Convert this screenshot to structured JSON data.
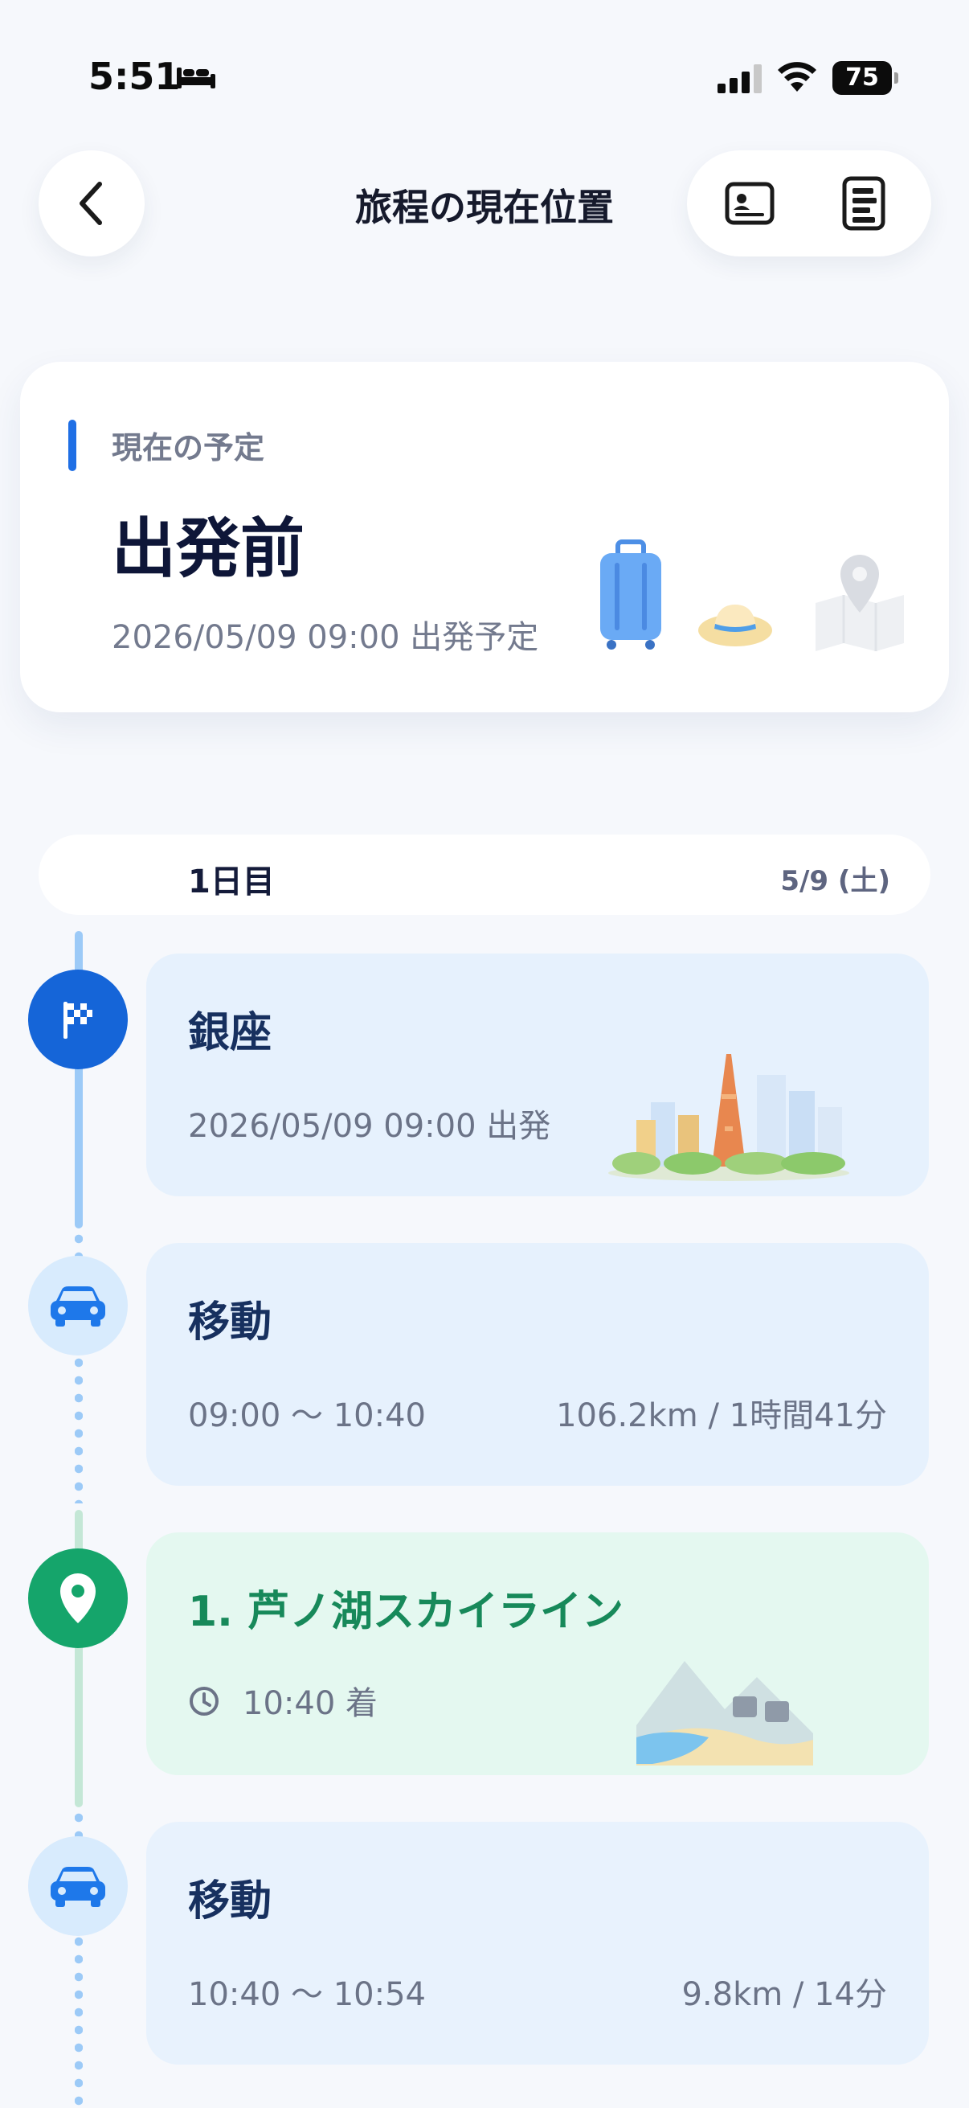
{
  "status_bar": {
    "time": "5:51",
    "battery": "75"
  },
  "header": {
    "title": "旅程の現在位置"
  },
  "current": {
    "label": "現在の予定",
    "status": "出発前",
    "subtitle": "2026/05/09 09:00 出発予定"
  },
  "day": {
    "label": "1日目",
    "date": "5/9 (土)"
  },
  "timeline": [
    {
      "kind": "start",
      "title": "銀座",
      "subtitle": "2026/05/09 09:00 出発",
      "icon": "flag-icon"
    },
    {
      "kind": "move",
      "title": "移動",
      "time": "09:00 〜 10:40",
      "distance": "106.2km / 1時間41分",
      "icon": "car-icon"
    },
    {
      "kind": "spot",
      "title": "1. 芦ノ湖スカイライン",
      "arrival": "10:40 着",
      "icon": "location-pin-icon"
    },
    {
      "kind": "move",
      "title": "移動",
      "time": "10:40 〜 10:54",
      "distance": "9.8km / 14分",
      "icon": "car-icon"
    }
  ],
  "colors": {
    "accent": "#1f6fe5",
    "move_card": "#e6f1fd",
    "spot_card": "#e4f8f0",
    "spot_title": "#17895a",
    "line_blue": "#9ccaf7",
    "line_green": "#c4e7d6"
  }
}
